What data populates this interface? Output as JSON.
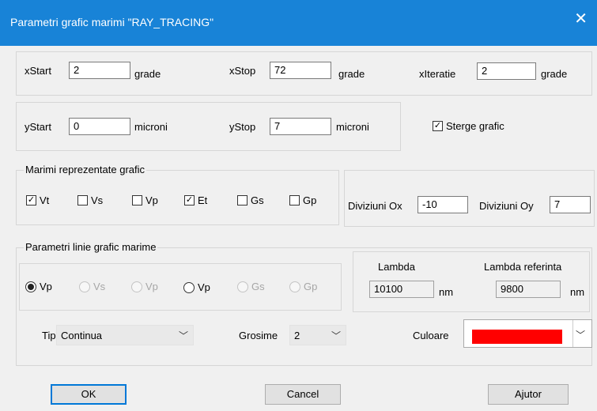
{
  "dialog": {
    "title": "Parametri grafic marimi \"RAY_TRACING\"",
    "close_glyph": "✕"
  },
  "x_range": {
    "start_label": "xStart",
    "start_value": "2",
    "start_unit": "grade",
    "stop_label": "xStop",
    "stop_value": "72",
    "stop_unit": "grade",
    "iter_label": "xIteratie",
    "iter_value": "2",
    "iter_unit": "grade"
  },
  "y_range": {
    "start_label": "yStart",
    "start_value": "0",
    "start_unit": "microni",
    "stop_label": "yStop",
    "stop_value": "7",
    "stop_unit": "microni"
  },
  "clear_graph": {
    "label": "Sterge grafic",
    "checked": true
  },
  "quantities": {
    "legend": "Marimi reprezentate grafic",
    "items": [
      {
        "label": "Vt",
        "checked": true
      },
      {
        "label": "Vs",
        "checked": false
      },
      {
        "label": "Vp",
        "checked": false
      },
      {
        "label": "Et",
        "checked": true
      },
      {
        "label": "Gs",
        "checked": false
      },
      {
        "label": "Gp",
        "checked": false
      }
    ]
  },
  "divisions": {
    "ox_label": "Diviziuni Ox",
    "ox_value": "-10",
    "oy_label": "Diviziuni Oy",
    "oy_value": "7"
  },
  "line_params": {
    "legend": "Parametri linie grafic marime",
    "radios": [
      {
        "label": "Vp",
        "selected": true,
        "enabled": true
      },
      {
        "label": "Vs",
        "selected": false,
        "enabled": false
      },
      {
        "label": "Vp",
        "selected": false,
        "enabled": false
      },
      {
        "label": "Vp",
        "selected": false,
        "enabled": true
      },
      {
        "label": "Gs",
        "selected": false,
        "enabled": false
      },
      {
        "label": "Gp",
        "selected": false,
        "enabled": false
      }
    ]
  },
  "lambda": {
    "label": "Lambda",
    "value": "10100",
    "unit": "nm",
    "ref_label": "Lambda referinta",
    "ref_value": "9800",
    "ref_unit": "nm"
  },
  "style": {
    "type_label": "Tip",
    "type_value": "Continua",
    "thickness_label": "Grosime",
    "thickness_value": "2",
    "color_label": "Culoare",
    "color_value": "#ff0000"
  },
  "buttons": {
    "ok": "OK",
    "cancel": "Cancel",
    "help": "Ajutor"
  },
  "colors": {
    "accent": "#1883d7",
    "default_button_border": "#0078d7"
  }
}
